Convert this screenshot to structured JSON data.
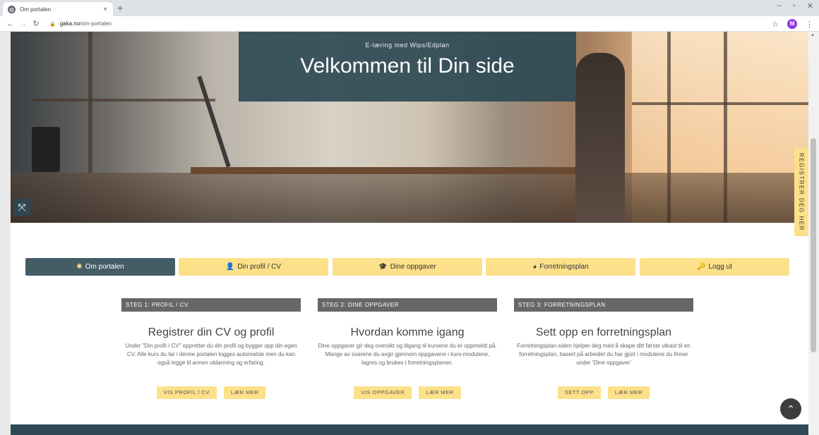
{
  "browser": {
    "tab_title": "Om portalen",
    "tab_close": "×",
    "new_tab": "+",
    "url_domain": "gaka.no",
    "url_path": "/om-portalen",
    "avatar_letter": "M",
    "win_min": "–",
    "win_max": "▫",
    "win_close": "✕"
  },
  "hero": {
    "kicker": "E-læring med Wips/Edplan",
    "title": "Velkommen til Din side"
  },
  "register_tab": "REGISTRER DEG HER",
  "nav": [
    {
      "label": "Om portalen",
      "icon": "lightbulb-icon",
      "glyph": "✺"
    },
    {
      "label": "Din profil / CV",
      "icon": "user-icon",
      "glyph": "👤"
    },
    {
      "label": "Dine oppgaver",
      "icon": "graduation-cap-icon",
      "glyph": "🎓"
    },
    {
      "label": "Forretningsplan",
      "icon": "pie-chart-icon",
      "glyph": "◕"
    },
    {
      "label": "Logg ut",
      "icon": "key-icon",
      "glyph": "🔑"
    }
  ],
  "steps": [
    {
      "header": "STEG 1: PROFIL / CV",
      "title": "Registrer din CV og profil",
      "text": "Under \"Din profil / CV\" oppretter du din profil og bygger opp din egen CV. Alle kurs du tar i denne portalen logges automatisk men du kan også legge til annen utdanning og erfaring.",
      "primary": "VIS PROFIL / CV",
      "secondary": "LÆR MER"
    },
    {
      "header": "STEG 2: DINE OPPGAVER",
      "title": "Hvordan komme igang",
      "text": "Dine oppgaver gir deg oversikt og tilgang til kursene du er oppmeldt på. Mange av svarene du avgir gjennom oppgavene i kurs-modulene, lagres og brukes i forretningsplanen.",
      "primary": "VIS OPPGAVER",
      "secondary": "LÆR MER"
    },
    {
      "header": "STEG 3: FORRETNINGSPLAN",
      "title": "Sett opp en forretningsplan",
      "text": "Forretningsplan-siden hjelper deg med å skape ditt første utkast til en forretningsplan, basert på arbeidet du har gjort i modulene du finner under 'Dine oppgaver'",
      "primary": "SETT OPP",
      "secondary": "LÆR MER"
    }
  ],
  "colors": {
    "accent_yellow": "#fde08a",
    "nav_active": "#445c66",
    "hero_box": "#2e4954",
    "step_header": "#676767",
    "footer": "#2f4a55"
  }
}
